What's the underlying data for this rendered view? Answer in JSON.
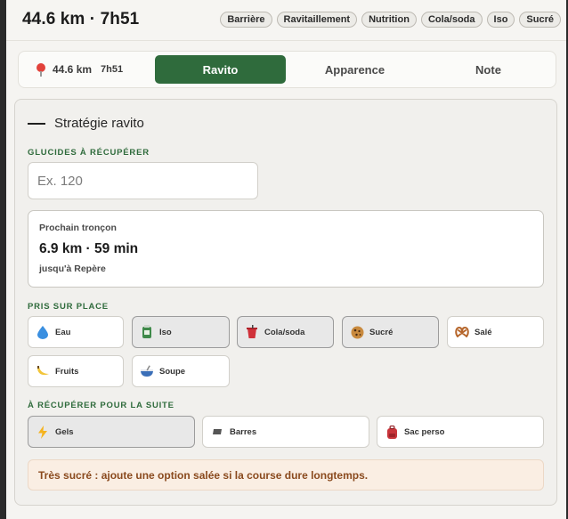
{
  "header": {
    "title": "44.6 km · 7h51",
    "chips": [
      "Barrière",
      "Ravitaillement",
      "Nutrition",
      "Cola/soda",
      "Iso",
      "Sucré"
    ]
  },
  "tabs": {
    "distance": "44.6 km",
    "time": "7h51",
    "active": "Ravito",
    "appearance": "Apparence",
    "note": "Note"
  },
  "panel": {
    "title": "Stratégie ravito",
    "glucides_label": "GLUCIDES À RÉCUPÉRER",
    "glucides_placeholder": "Ex. 120",
    "next": {
      "label": "Prochain tronçon",
      "value": "6.9 km · 59 min",
      "sub": "jusqu'à Repère"
    },
    "onsite_label": "PRIS SUR PLACE",
    "onsite": [
      {
        "label": "Eau",
        "icon": "water-drop-icon",
        "selected": false
      },
      {
        "label": "Iso",
        "icon": "iso-drink-icon",
        "selected": true
      },
      {
        "label": "Cola/soda",
        "icon": "soda-cup-icon",
        "selected": true
      },
      {
        "label": "Sucré",
        "icon": "cookie-icon",
        "selected": true
      },
      {
        "label": "Salé",
        "icon": "pretzel-icon",
        "selected": false
      },
      {
        "label": "Fruits",
        "icon": "banana-icon",
        "selected": false
      },
      {
        "label": "Soupe",
        "icon": "soup-bowl-icon",
        "selected": false
      }
    ],
    "pickup_label": "À RÉCUPÉRER POUR LA SUITE",
    "pickup": [
      {
        "label": "Gels",
        "icon": "lightning-icon",
        "selected": true
      },
      {
        "label": "Barres",
        "icon": "bar-icon",
        "selected": false
      },
      {
        "label": "Sac perso",
        "icon": "backpack-icon",
        "selected": false
      }
    ],
    "warning": "Très sucré : ajoute une option salée si la course dure longtemps."
  },
  "colors": {
    "accent_green": "#2f6b3c",
    "warning_bg": "#faeee3",
    "warning_text": "#8a4a1e"
  }
}
